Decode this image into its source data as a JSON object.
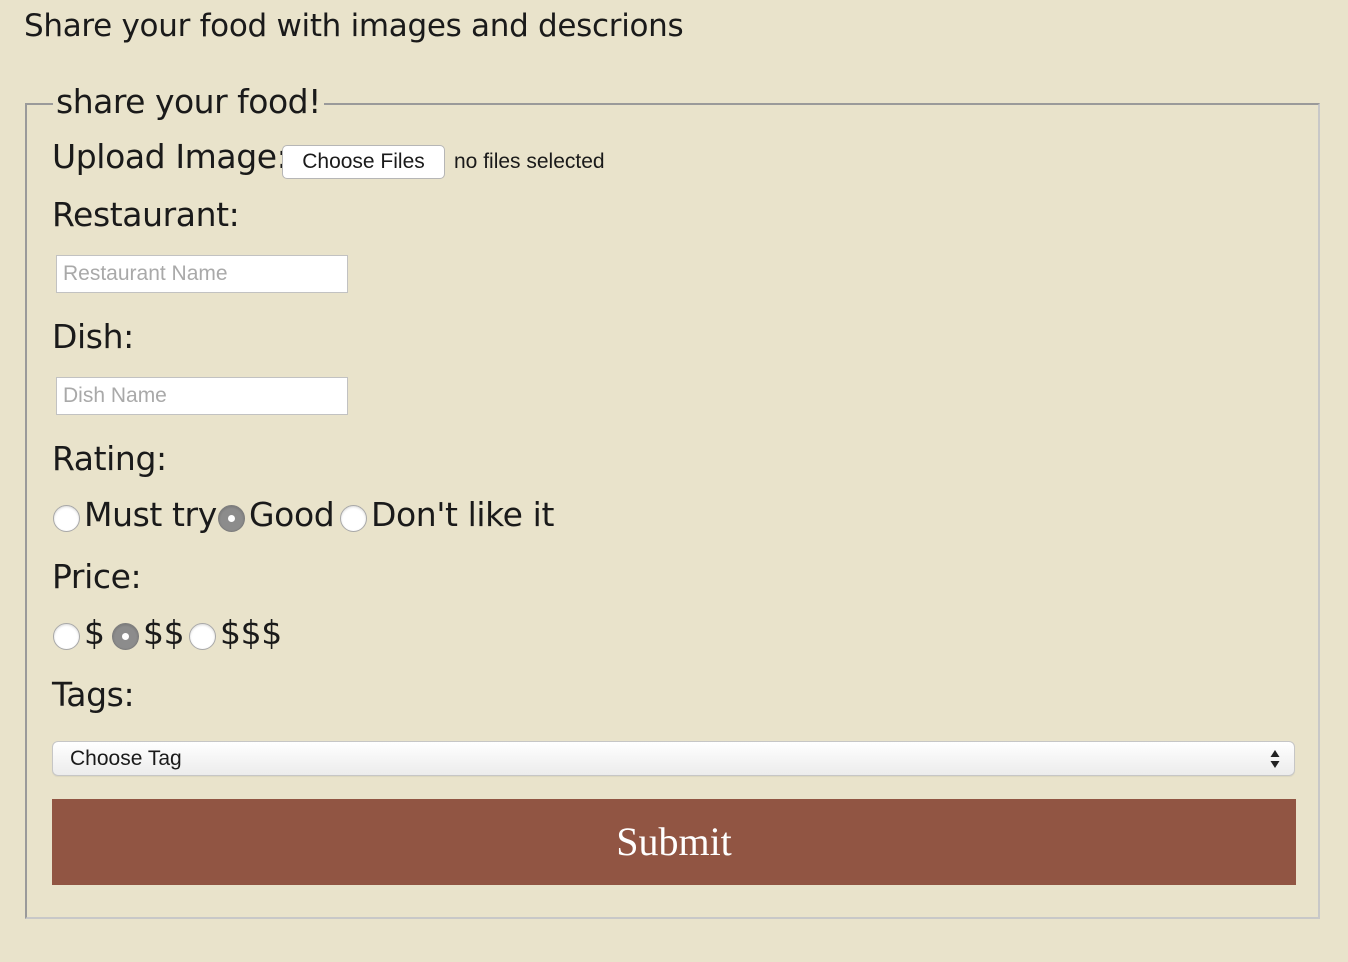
{
  "page": {
    "heading": "Share your food with images and descrions"
  },
  "form": {
    "legend": "share your food!",
    "upload": {
      "label": "Upload Image:",
      "button_label": "Choose Files",
      "status": "no files selected"
    },
    "restaurant": {
      "label": "Restaurant:",
      "placeholder": "Restaurant Name",
      "value": ""
    },
    "dish": {
      "label": "Dish:",
      "placeholder": "Dish Name",
      "value": ""
    },
    "rating": {
      "label": "Rating:",
      "options": [
        {
          "label": "Must try",
          "checked": false
        },
        {
          "label": "Good",
          "checked": true
        },
        {
          "label": "Don't like it",
          "checked": false
        }
      ]
    },
    "price": {
      "label": "Price:",
      "options": [
        {
          "label": "$",
          "checked": false
        },
        {
          "label": "$$",
          "checked": true
        },
        {
          "label": "$$$",
          "checked": false
        }
      ]
    },
    "tags": {
      "label": "Tags:",
      "selected": "Choose Tag"
    },
    "submit_label": "Submit"
  },
  "colors": {
    "background": "#e9e3cb",
    "submit_button": "#915543",
    "submit_text": "#ffffff",
    "radio_checked": "#8c8c8c"
  },
  "icons": {
    "select_arrows": "up-down-arrows-icon"
  }
}
